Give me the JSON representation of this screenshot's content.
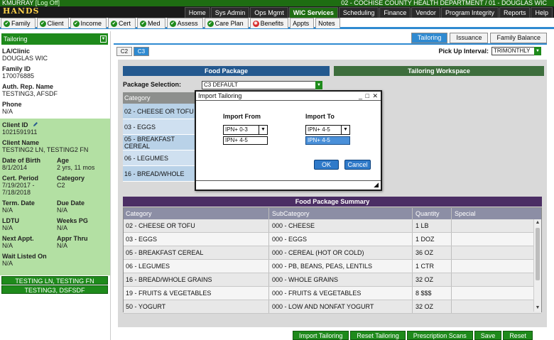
{
  "header": {
    "user": "KMURRAY",
    "logout": "[Log Off]",
    "logo_text": "HANDS",
    "department": "02 - COCHISE COUNTY HEALTH DEPARTMENT / 01 - DOUGLAS WIC"
  },
  "main_nav": [
    "Home",
    "Sys Admin",
    "Ops Mgmt",
    "WIC Services",
    "Scheduling",
    "Finance",
    "Vendor",
    "Program Integrity",
    "Reports",
    "Help"
  ],
  "main_nav_active": "WIC Services",
  "module_tabs": [
    {
      "label": "Family",
      "status": "check"
    },
    {
      "label": "Client",
      "status": "check"
    },
    {
      "label": "Income",
      "status": "check"
    },
    {
      "label": "Cert",
      "status": "check"
    },
    {
      "label": "Med",
      "status": "check"
    },
    {
      "label": "Assess",
      "status": "check"
    },
    {
      "label": "Care Plan",
      "status": "check"
    },
    {
      "label": "Benefits",
      "status": "error"
    },
    {
      "label": "Appts",
      "status": "none"
    },
    {
      "label": "Notes",
      "status": "none"
    }
  ],
  "left_panel": {
    "dropdown": "Tailoring",
    "la_clinic_label": "LA/Clinic",
    "la_clinic": "DOUGLAS WIC",
    "family_id_label": "Family ID",
    "family_id": "170076885",
    "auth_rep_label": "Auth. Rep. Name",
    "auth_rep": "TESTING3, AFSDF",
    "phone_label": "Phone",
    "phone": "N/A",
    "client_id_label": "Client ID",
    "client_id": "1021591911",
    "client_name_label": "Client Name",
    "client_name": "TESTING2 LN, TESTING2 FN",
    "dob_label": "Date of Birth",
    "dob": "8/1/2014",
    "age_label": "Age",
    "age": "2 yrs, 11 mos",
    "cert_period_label": "Cert. Period",
    "cert_period_start": "7/19/2017 -",
    "cert_period_end": "7/18/2018",
    "category_label": "Category",
    "category": "C2",
    "term_date_label": "Term. Date",
    "term_date": "N/A",
    "due_date_label": "Due Date",
    "due_date": "N/A",
    "ldtu_label": "LDTU",
    "ldtu": "N/A",
    "weeks_pg_label": "Weeks PG",
    "weeks_pg": "N/A",
    "next_appt_label": "Next Appt.",
    "next_appt": "N/A",
    "appr_thru_label": "Appr Thru",
    "appr_thru": "N/A",
    "wait_listed_label": "Wait Listed On",
    "wait_listed": "N/A",
    "family_buttons": [
      "TESTING LN, TESTING FN",
      "TESTING3, DSFSDF"
    ]
  },
  "right_tabs": [
    "Tailoring",
    "Issuance",
    "Family Balance"
  ],
  "right_tabs_active": "Tailoring",
  "sub_tabs": [
    "C2",
    "C3"
  ],
  "sub_tabs_active": "C3",
  "pickup": {
    "label": "Pick Up Interval:",
    "value": "TRIMONTHLY"
  },
  "food_package": {
    "header": "Food Package",
    "selection_label": "Package Selection:",
    "selection_value": "C3 DEFAULT",
    "column": "Category",
    "rows": [
      "02 - CHEESE OR TOFU",
      "03 - EGGS",
      "05 - BREAKFAST CEREAL",
      "06 - LEGUMES",
      "16 - BREAD/WHOLE"
    ]
  },
  "tailoring_workspace": {
    "header": "Tailoring Workspace"
  },
  "summary": {
    "header": "Food Package Summary",
    "columns": [
      "Category",
      "SubCategory",
      "Quantity",
      "Special"
    ],
    "rows": [
      {
        "category": "02 - CHEESE OR TOFU",
        "sub": "000 - CHEESE",
        "qty": "1 LB",
        "special": ""
      },
      {
        "category": "03 - EGGS",
        "sub": "000 - EGGS",
        "qty": "1 DOZ",
        "special": ""
      },
      {
        "category": "05 - BREAKFAST CEREAL",
        "sub": "000 - CEREAL (HOT OR COLD)",
        "qty": "36 OZ",
        "special": ""
      },
      {
        "category": "06 - LEGUMES",
        "sub": "000 - PB, BEANS, PEAS, LENTILS",
        "qty": "1 CTR",
        "special": ""
      },
      {
        "category": "16 - BREAD/WHOLE GRAINS",
        "sub": "000 - WHOLE GRAINS",
        "qty": "32 OZ",
        "special": ""
      },
      {
        "category": "19 - FRUITS & VEGETABLES",
        "sub": "000 - FRUITS & VEGETABLES",
        "qty": "8 $$$",
        "special": ""
      },
      {
        "category": "50 - YOGURT",
        "sub": "000 - LOW AND NONFAT YOGURT",
        "qty": "32 OZ",
        "special": ""
      }
    ]
  },
  "bottom_buttons": [
    "Import Tailoring",
    "Reset Tailoring",
    "Prescription Scans",
    "Save",
    "Reset"
  ],
  "modal": {
    "title": "Import Tailoring",
    "window_controls": "_ □ ✕",
    "import_from_label": "Import From",
    "import_from_value": "IPN+ 0-3",
    "import_from_option": "IPN+ 4-5",
    "import_to_label": "Import To",
    "import_to_value": "IPN+ 4-5",
    "import_to_option": "IPN+ 4-5",
    "ok": "OK",
    "cancel": "Cancel"
  },
  "colors": {
    "header_green": "#1e6d12",
    "accent_blue": "#2f8ad1",
    "client_green": "#b3e0a3",
    "food_package_blue": "#24598f",
    "workspace_green": "#3e6e3d",
    "summary_purple": "#4b2e64"
  }
}
